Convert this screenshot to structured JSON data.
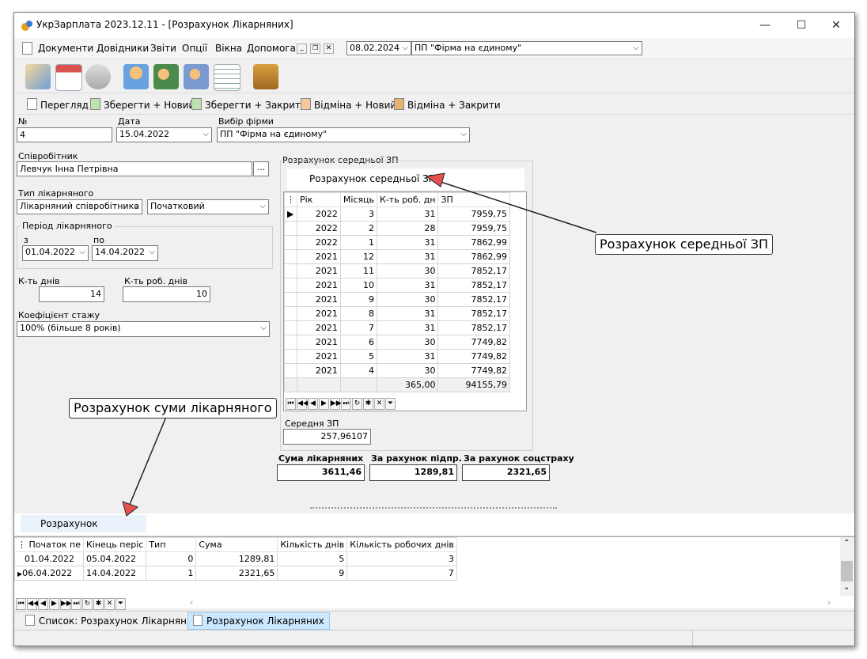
{
  "window": {
    "title": "УкрЗарплата 2023.12.11 - [Розрахунок Лікарняних]",
    "minimize": "—",
    "maximize": "☐",
    "close": "✕"
  },
  "menu": {
    "items": [
      "Документи",
      "Довідники",
      "Звіти",
      "Опції",
      "Вікна",
      "Допомога"
    ],
    "date": "08.02.2024",
    "firm": "ПП \"Фірма на єдиному\""
  },
  "toolbar2": {
    "view": "Перегляд",
    "save_new": "Зберегти + Новий",
    "save_close": "Зберегти + Закрити",
    "cancel_new": "Відміна + Новий",
    "cancel_close": "Відміна + Закрити"
  },
  "form": {
    "num_label": "№",
    "num": "4",
    "date_label": "Дата",
    "date": "15.04.2022",
    "firm_label": "Вибір фірми",
    "firm": "ПП \"Фірма на єдиному\"",
    "employee_label": "Співробітник",
    "employee": "Левчук Інна Петрівна",
    "type_label": "Тип лікарняного",
    "type": "Лікарняний співробітника",
    "kind": "Початковий",
    "period_label": "Період лікарняного",
    "from_label": "з",
    "from": "01.04.2022",
    "to_label": "по",
    "to": "14.04.2022",
    "days_label": "К-ть днів",
    "days": "14",
    "work_days_label": "К-ть роб. днів",
    "work_days": "10",
    "coef_label": "Коефіцієнт стажу",
    "coef": "100% (більше 8 років)"
  },
  "avg": {
    "group_label": "Розрахунок середньої ЗП",
    "tab": "Розрахунок середньої ЗП",
    "headers": [
      "Рік",
      "Місяць",
      "К-ть роб. дн",
      "ЗП"
    ],
    "rows": [
      [
        "2022",
        "3",
        "31",
        "7959,75"
      ],
      [
        "2022",
        "2",
        "28",
        "7959,75"
      ],
      [
        "2022",
        "1",
        "31",
        "7862,99"
      ],
      [
        "2021",
        "12",
        "31",
        "7862,99"
      ],
      [
        "2021",
        "11",
        "30",
        "7852,17"
      ],
      [
        "2021",
        "10",
        "31",
        "7852,17"
      ],
      [
        "2021",
        "9",
        "30",
        "7852,17"
      ],
      [
        "2021",
        "8",
        "31",
        "7852,17"
      ],
      [
        "2021",
        "7",
        "31",
        "7852,17"
      ],
      [
        "2021",
        "6",
        "30",
        "7749,82"
      ],
      [
        "2021",
        "5",
        "31",
        "7749,82"
      ],
      [
        "2021",
        "4",
        "30",
        "7749,82"
      ]
    ],
    "total_days": "365,00",
    "total_zp": "94155,79",
    "avg_label": "Середня ЗП",
    "avg_value": "257,96107"
  },
  "sums": {
    "sick_label": "Сума лікарняних",
    "sick": "3611,46",
    "company_label": "За рахунок підпр.",
    "company": "1289,81",
    "social_label": "За рахунок соцстраху",
    "social": "2321,65"
  },
  "callouts": {
    "avg": "Розрахунок середньої ЗП",
    "sum": "Розрахунок суми лікарняного"
  },
  "bottom": {
    "tab": "Розрахунок лікарняних",
    "headers": [
      "Початок пе",
      "Кінець періс",
      "Тип",
      "Сума",
      "Кількість днів",
      "Кількість робочих днів"
    ],
    "rows": [
      [
        "01.04.2022",
        "05.04.2022",
        "0",
        "1289,81",
        "5",
        "3"
      ],
      [
        "06.04.2022",
        "14.04.2022",
        "1",
        "2321,65",
        "9",
        "7"
      ]
    ]
  },
  "tabs": {
    "list": "Список: Розрахунок Лікарняних",
    "doc": "Розрахунок Лікарняних"
  },
  "colors": {
    "accent": "#cce8ff",
    "arrow": "#e85050"
  }
}
